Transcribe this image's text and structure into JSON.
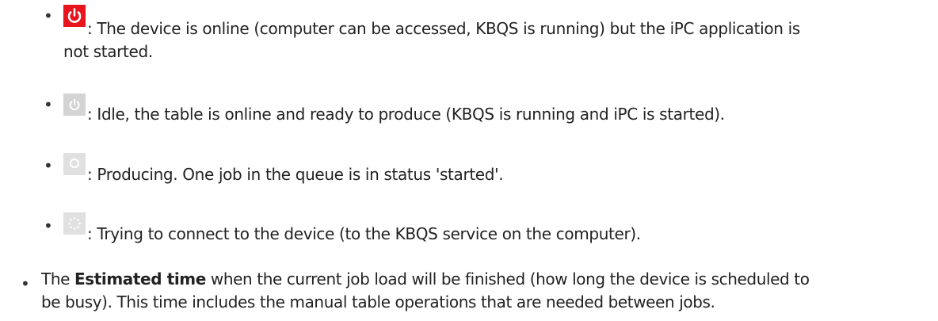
{
  "status_items": [
    {
      "icon": "power-red-icon",
      "icon_color": "#e8141e",
      "text_line1": ": The device is online (computer can be accessed, KBQS is running) but the iPC application is",
      "text_line2": "not started."
    },
    {
      "icon": "power-grey-icon",
      "icon_color": "#d4d4d4",
      "text_line1": ": Idle, the table is online and ready to produce (KBQS is running and iPC is started)."
    },
    {
      "icon": "producing-ring-icon",
      "icon_color": "#d4d4d4",
      "text_line1": ": Producing. One job in the queue is in status 'started'."
    },
    {
      "icon": "connecting-spinner-icon",
      "icon_color": "#d4d4d4",
      "text_line1": ": Trying to connect to the device (to the KBQS service on the computer)."
    }
  ],
  "estimated": {
    "prefix": "The ",
    "bold": "Estimated time",
    "line1_rest": " when the current job load will be finished (how long the device is scheduled to",
    "line2": "be busy). This time includes the manual table operations that are needed between jobs."
  }
}
